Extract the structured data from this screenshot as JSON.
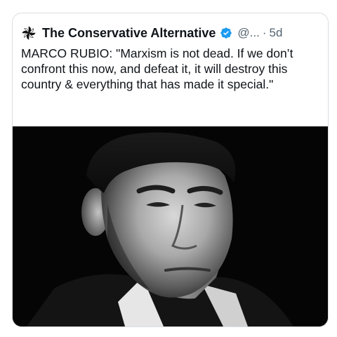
{
  "tweet": {
    "display_name": "The Conservative Alternative",
    "handle": "@...",
    "separator": "·",
    "time": "5d",
    "text": "MARCO RUBIO: \"Marxism is not dead. If we don’t confront this now, and defeat it, it will destroy this country & everything that has made it special.\"",
    "avatar_icon": "pinwheel-logo-icon",
    "verified_icon": "verified-badge-icon",
    "verified_color": "#1d9bf0",
    "media": {
      "type": "photo",
      "style": "black-and-white portrait"
    }
  }
}
